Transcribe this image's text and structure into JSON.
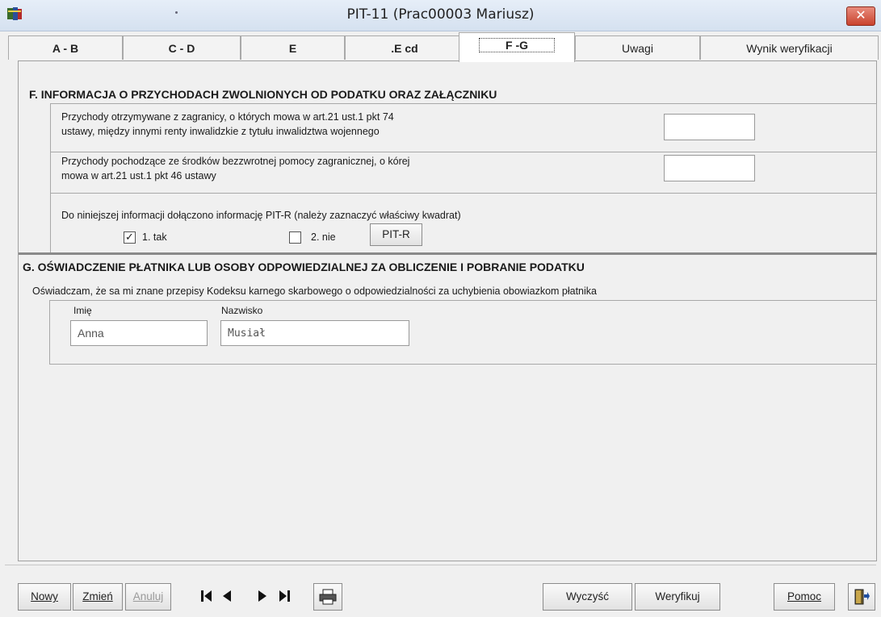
{
  "window": {
    "title": "PIT-11 (Prac00003 Mariusz)",
    "close_symbol": "✕"
  },
  "tabs": [
    {
      "label": "A - B"
    },
    {
      "label": "C - D"
    },
    {
      "label": "E"
    },
    {
      "label": ".E cd"
    },
    {
      "label": "F -G"
    },
    {
      "label": "Uwagi"
    },
    {
      "label": "Wynik weryfikacji"
    }
  ],
  "section_f": {
    "title": "F. INFORMACJA O PRZYCHODACH ZWOLNIONYCH OD PODATKU ORAZ ZAŁĄCZNIKU",
    "row1_line1": "Przychody otrzymywane z zagranicy, o których mowa w art.21 ust.1 pkt 74",
    "row1_line2": "ustawy, między innymi renty inwalidzkie z tytułu inwalidztwa wojennego",
    "row1_value": "",
    "row2_line1": "Przychody pochodzące ze środków bezzwrotnej pomocy zagranicznej, o kórej",
    "row2_line2": "mowa w art.21 ust.1 pkt 46 ustawy",
    "row2_value": "",
    "attachment_text": "Do niniejszej informacji dołączono informację PIT-R (należy zaznaczyć właściwy kwadrat)",
    "option_yes": "1. tak",
    "option_yes_checked": true,
    "option_no": "2. nie",
    "option_no_checked": false,
    "pitr_button": "PIT-R"
  },
  "section_g": {
    "title": "G. OŚWIADCZENIE PŁATNIKA LUB OSOBY ODPOWIEDZIALNEJ ZA OBLICZENIE I POBRANIE PODATKU",
    "statement": "Oświadczam, że sa mi znane przepisy Kodeksu karnego skarbowego o odpowiedzialności za uchybienia obowiazkom płatnika",
    "first_name_label": "Imię",
    "first_name_value": "Anna",
    "last_name_label": "Nazwisko",
    "last_name_value": "Musiał"
  },
  "toolbar": {
    "new_label": "Nowy",
    "edit_label": "Zmień",
    "cancel_label": "Anuluj",
    "clear_label": "Wyczyść",
    "verify_label": "Weryfikuj",
    "help_label": "Pomoc",
    "navigation_icons": [
      "first-record-icon",
      "previous-record-icon",
      "next-record-icon",
      "last-record-icon"
    ],
    "print_icon": "printer-icon",
    "exit_icon": "exit-door-icon"
  },
  "colors": {
    "title_bar": "#d5e1f0",
    "close_button": "#c9432e",
    "panel": "#f0f0f0"
  }
}
